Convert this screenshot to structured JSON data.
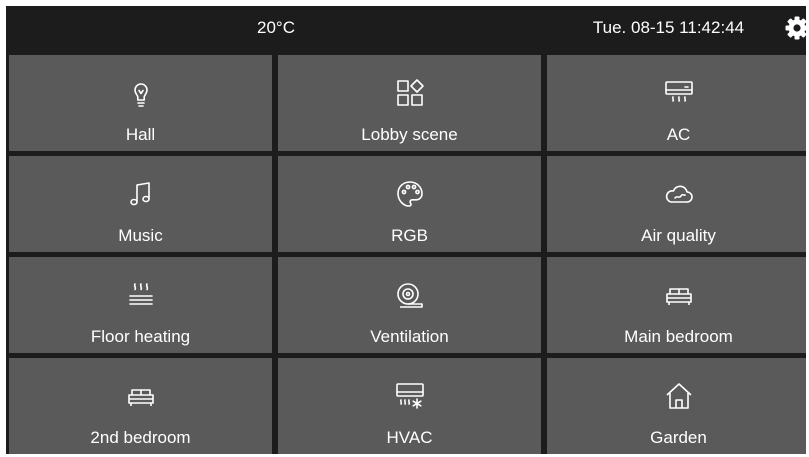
{
  "status_bar": {
    "temperature": "20°C",
    "datetime": "Tue. 08-15 11:42:44",
    "settings_icon": "gear-icon"
  },
  "tiles": [
    {
      "label": "Hall",
      "icon": "lightbulb-icon"
    },
    {
      "label": "Lobby scene",
      "icon": "scene-grid-icon"
    },
    {
      "label": "AC",
      "icon": "air-conditioner-icon"
    },
    {
      "label": "Music",
      "icon": "music-note-icon"
    },
    {
      "label": "RGB",
      "icon": "palette-icon"
    },
    {
      "label": "Air quality",
      "icon": "cloud-icon"
    },
    {
      "label": "Floor heating",
      "icon": "floor-heating-icon"
    },
    {
      "label": "Ventilation",
      "icon": "fan-icon"
    },
    {
      "label": "Main bedroom",
      "icon": "sofa-icon"
    },
    {
      "label": "2nd bedroom",
      "icon": "sofa-icon"
    },
    {
      "label": "HVAC",
      "icon": "hvac-icon"
    },
    {
      "label": "Garden",
      "icon": "house-icon"
    }
  ],
  "colors": {
    "background": "#1c1c1c",
    "tile": "#5a5a5a",
    "text": "#ffffff"
  }
}
